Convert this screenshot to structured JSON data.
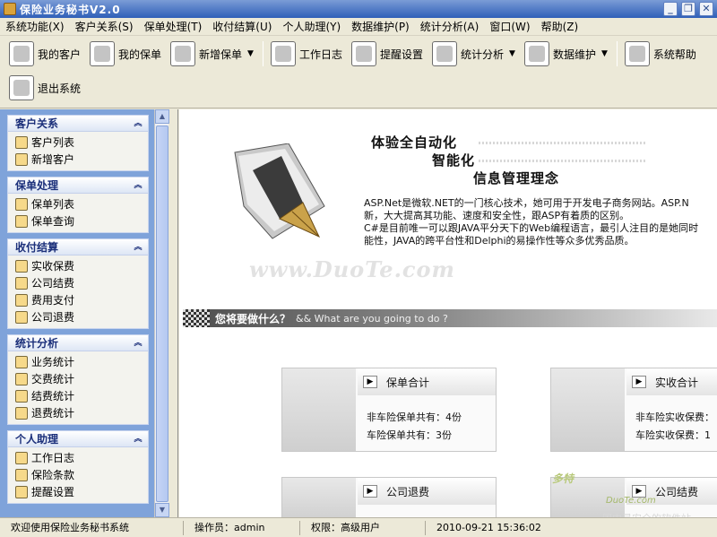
{
  "window": {
    "title": "保险业务秘书V2.0"
  },
  "menu": [
    "系统功能(X)",
    "客户关系(S)",
    "保单处理(T)",
    "收付结算(U)",
    "个人助理(Y)",
    "数据维护(P)",
    "统计分析(A)",
    "窗口(W)",
    "帮助(Z)"
  ],
  "toolbar": {
    "row1": [
      {
        "label": "我的客户",
        "icon": "customers-icon"
      },
      {
        "label": "我的保单",
        "icon": "policies-icon"
      },
      {
        "label": "新增保单",
        "icon": "new-policy-icon",
        "dropdown": true
      },
      {
        "label": "工作日志",
        "icon": "work-log-icon"
      },
      {
        "label": "提醒设置",
        "icon": "reminder-icon"
      },
      {
        "label": "统计分析",
        "icon": "statistics-icon",
        "dropdown": true
      },
      {
        "label": "数据维护",
        "icon": "data-maintenance-icon",
        "dropdown": true
      },
      {
        "label": "系统帮助",
        "icon": "help-icon"
      }
    ],
    "row2": [
      {
        "label": "退出系统",
        "icon": "exit-icon"
      }
    ]
  },
  "sidebar": {
    "groups": [
      {
        "title": "客户关系",
        "items": [
          "客户列表",
          "新增客户"
        ]
      },
      {
        "title": "保单处理",
        "items": [
          "保单列表",
          "保单查询"
        ]
      },
      {
        "title": "收付结算",
        "items": [
          "实收保费",
          "公司结费",
          "费用支付",
          "公司退费"
        ]
      },
      {
        "title": "统计分析",
        "items": [
          "业务统计",
          "交费统计",
          "结费统计",
          "退费统计"
        ]
      },
      {
        "title": "个人助理",
        "items": [
          "工作日志",
          "保险条款",
          "提醒设置"
        ]
      }
    ]
  },
  "main": {
    "slogan": [
      "体验全自动化",
      "智能化",
      "信息管理理念"
    ],
    "intro": [
      "ASP.Net是微软.NET的一门核心技术，她可用于开发电子商务网站。ASP.N",
      "新，大大提高其功能、速度和安全性，跟ASP有着质的区别。",
      "C#是目前唯一可以跟JAVA平分天下的Web编程语言，最引人注目的是她同时",
      "能性，JAVA的跨平台性和Delphi的易操作性等众多优秀品质。"
    ],
    "watermark": "www.DuoTe.com",
    "banner": {
      "cn": "您将要做什么？",
      "en": "&& What are you going to do ?"
    },
    "cards": [
      {
        "title": "保单合计",
        "lines": [
          "非车险保单共有：4份",
          "车险保单共有：3份"
        ]
      },
      {
        "title": "实收合计",
        "lines": [
          "非车险实收保费：",
          "车险实收保费：1"
        ]
      },
      {
        "title": "公司退费",
        "lines": []
      },
      {
        "title": "公司结费",
        "lines": []
      }
    ],
    "credit": [
      "多特",
      "DuoTe.com",
      "国内最安全的软件站"
    ]
  },
  "status": [
    "欢迎使用保险业务秘书系统",
    "操作员：admin",
    "权限：高级用户",
    "2010-09-21 15:36:02"
  ],
  "colors": {
    "titlebar": "#2f5fb8",
    "sidebar": "#7fa3da",
    "group_title": "#1b2f7a"
  }
}
